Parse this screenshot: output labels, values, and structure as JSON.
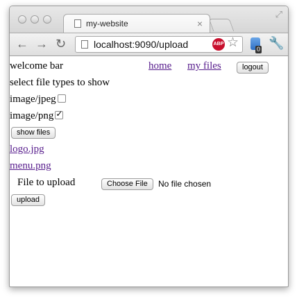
{
  "browser": {
    "tab_title": "my-website",
    "tab_close": "×",
    "url": "localhost:9090/upload",
    "abp_label": "ABP",
    "extension_badge": "0"
  },
  "page": {
    "welcome": "welcome bar",
    "nav": {
      "home": "home",
      "my_files": "my files",
      "logout": "logout"
    },
    "filter_heading": "select file types to show",
    "filters": [
      {
        "label": "image/jpeg",
        "checked": false
      },
      {
        "label": "image/png",
        "checked": true
      }
    ],
    "show_files_label": "show files",
    "files": [
      "logo.jpg",
      "menu.png"
    ],
    "upload_label": "File to upload",
    "choose_file_label": "Choose File",
    "no_file_text": "No file chosen",
    "upload_button": "upload"
  }
}
